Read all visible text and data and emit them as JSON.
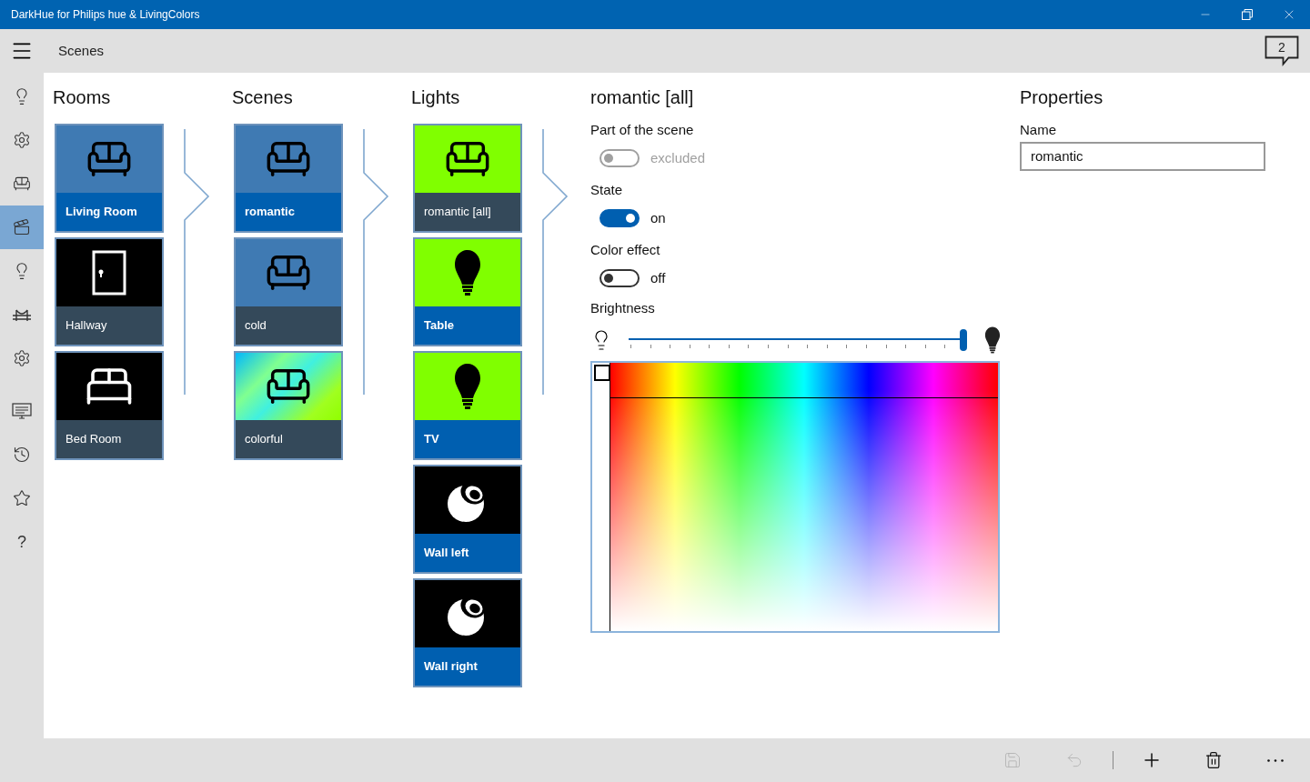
{
  "window": {
    "title": "DarkHue for Philips hue & LivingColors"
  },
  "header": {
    "title": "Scenes",
    "notification_count": "2"
  },
  "sidebar": {
    "items": [
      {
        "kind": "bulb-rays",
        "selected": false
      },
      {
        "kind": "gear",
        "selected": false
      },
      {
        "kind": "sofa",
        "selected": false
      },
      {
        "kind": "clapper",
        "selected": true
      },
      {
        "kind": "bulb",
        "selected": false
      },
      {
        "kind": "bridge",
        "selected": false
      },
      {
        "kind": "gear",
        "selected": false
      },
      {
        "kind": "monitor",
        "selected": false
      },
      {
        "kind": "history",
        "selected": false
      },
      {
        "kind": "star",
        "selected": false
      },
      {
        "kind": "text",
        "label": "?",
        "selected": false
      }
    ]
  },
  "columns": [
    {
      "title": "Rooms",
      "tiles": [
        {
          "label": "Living Room",
          "kind": "lounge",
          "selected": true
        },
        {
          "label": "Hallway",
          "kind": "hall",
          "selected": false
        },
        {
          "label": "Bed Room",
          "kind": "bedroom",
          "selected": false
        }
      ]
    },
    {
      "title": "Scenes",
      "tiles": [
        {
          "label": "romantic",
          "kind": "scene",
          "selected": true
        },
        {
          "label": "cold",
          "kind": "scene",
          "selected": false
        },
        {
          "label": "colorful",
          "kind": "multicolor",
          "selected": false
        }
      ]
    },
    {
      "title": "Lights",
      "tiles": [
        {
          "label": "romantic [all]",
          "kind": "group",
          "selected": false
        },
        {
          "label": "Table",
          "kind": "bulb",
          "selected": true
        },
        {
          "label": "TV",
          "kind": "bulb",
          "selected": true
        },
        {
          "label": "Wall left",
          "kind": "lamp",
          "selected": true
        },
        {
          "label": "Wall right",
          "kind": "lamp",
          "selected": true
        }
      ]
    }
  ],
  "detail": {
    "title": "romantic [all]",
    "toggles": [
      {
        "label": "Part of the scene",
        "value_text": "excluded",
        "on": false,
        "disabled": true
      },
      {
        "label": "State",
        "value_text": "on",
        "on": true,
        "disabled": false
      },
      {
        "label": "Color effect",
        "value_text": "off",
        "on": false,
        "disabled": false
      }
    ],
    "brightness": {
      "label": "Brightness",
      "level": 0.99
    }
  },
  "properties": {
    "title": "Properties",
    "name_label": "Name",
    "name_value": "romantic"
  },
  "command_bar": [
    {
      "kind": "save",
      "disabled": true
    },
    {
      "kind": "undo",
      "disabled": true
    },
    {
      "kind": "separator"
    },
    {
      "kind": "add",
      "disabled": false
    },
    {
      "kind": "delete",
      "disabled": false
    },
    {
      "kind": "more",
      "disabled": false
    }
  ]
}
